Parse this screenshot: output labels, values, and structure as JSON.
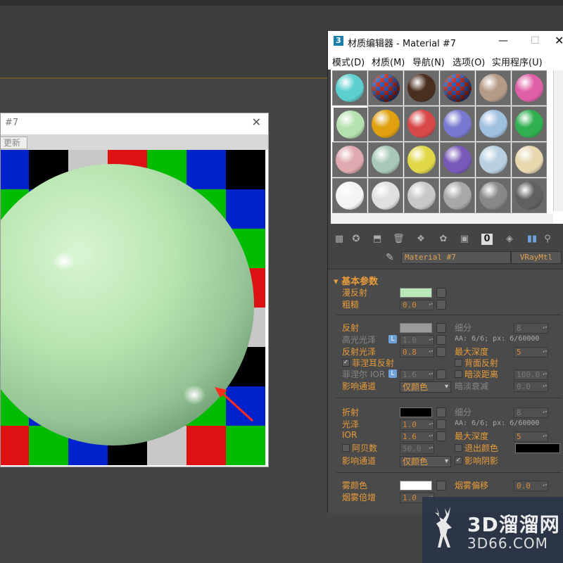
{
  "render_window": {
    "title": "#7",
    "update_button": "更新"
  },
  "material_editor": {
    "title": "材质编辑器 - Material #7",
    "menu": [
      "模式(D)",
      "材质(M)",
      "导航(N)",
      "选项(O)",
      "实用程序(U)"
    ],
    "slot_colors": [
      [
        "#5ccfcf",
        "checker",
        "#4a2e1e",
        "checker",
        "#b59a86",
        "#e060a8"
      ],
      [
        "#b5e0b0",
        "#e0a010",
        "#d84848",
        "#7878d0",
        "#a0c0e0",
        "#30b050"
      ],
      [
        "#e0a8b0",
        "#a8c8b8",
        "#e0d848",
        "#7858b8",
        "#b8d0e0",
        "#e8d8b0"
      ],
      [
        "#f4f4f4",
        "#e0e0e0",
        "#c8c8c8",
        "#a8a8a8",
        "#888888",
        "#606060"
      ]
    ],
    "active_slot": "r1c0",
    "material_name": "Material #7",
    "material_type": "VRayMtl"
  },
  "params": {
    "rollout_title": "基本参数",
    "diffuse": {
      "label": "漫反射",
      "color": "#b8e8b8"
    },
    "roughness": {
      "label": "粗糙",
      "value": "0.0"
    },
    "reflect": {
      "label": "反射",
      "color": "#9a9a9a"
    },
    "subdivs_label": "细分",
    "refl_subdivs": "8",
    "hilight": {
      "label": "高光光泽",
      "value": "1.0"
    },
    "aa1": "AA: 6/6; px: 6/60000",
    "refl_gloss": {
      "label": "反射光泽",
      "value": "0.8"
    },
    "max_depth_label": "最大深度",
    "refl_max_depth": "5",
    "fresnel": {
      "label": "菲涅耳反射",
      "checked": true
    },
    "back_reflect": "背面反射",
    "fresnel_ior": {
      "label": "菲涅尔 IOR",
      "value": "1.6"
    },
    "dim_distance": {
      "label": "暗淡距离",
      "value": "100.0"
    },
    "affect_channels_label": "影响通道",
    "refl_affect": "仅颜色",
    "dim_falloff": {
      "label": "暗淡衰减",
      "value": "0.0"
    },
    "refract": {
      "label": "折射",
      "color": "#000000"
    },
    "refr_subdivs": "8",
    "gloss": {
      "label": "光泽",
      "value": "1.0"
    },
    "aa2": "AA: 6/6; px: 6/60000",
    "ior": {
      "label": "IOR",
      "value": "1.6"
    },
    "refr_max_depth": "5",
    "abbe": {
      "label": "阿贝数",
      "value": "50.0"
    },
    "exit_color": {
      "label": "退出颜色",
      "color": "#000000"
    },
    "refr_affect": "仅颜色",
    "affect_shadows": {
      "label": "影响阴影",
      "checked": true
    },
    "fog_color": {
      "label": "雾颜色",
      "color": "#ffffff"
    },
    "fog_bias": {
      "label": "烟雾偏移",
      "value": "0.0"
    },
    "fog_mult": {
      "label": "烟雾倍增",
      "value": "1.0"
    }
  },
  "watermark": {
    "name": "3D溜溜网",
    "url": "3D66.COM"
  }
}
